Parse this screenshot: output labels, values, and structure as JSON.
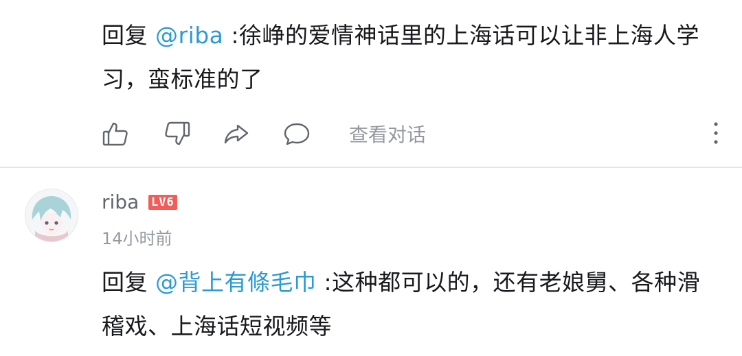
{
  "comment1": {
    "reply_prefix": "回复 ",
    "mention": "@riba",
    "text": " :徐峥的爱情神话里的上海话可以让非上海人学习，蛮标准的了"
  },
  "actions": {
    "view_conversation_label": "查看对话"
  },
  "comment2": {
    "username": "riba",
    "level_badge": "LV6",
    "timestamp": "14小时前",
    "reply_prefix": "回复 ",
    "mention": "@背上有條毛巾",
    "text": " :这种都可以的，还有老娘舅、各种滑稽戏、上海话短视频等"
  },
  "colors": {
    "text": "#18191c",
    "mention": "#2b9ad8",
    "muted": "#9499a0",
    "badge": "#f25d59"
  },
  "icons": [
    "thumbs-up-icon",
    "thumbs-down-icon",
    "share-icon",
    "comment-icon",
    "more-vertical-icon"
  ]
}
